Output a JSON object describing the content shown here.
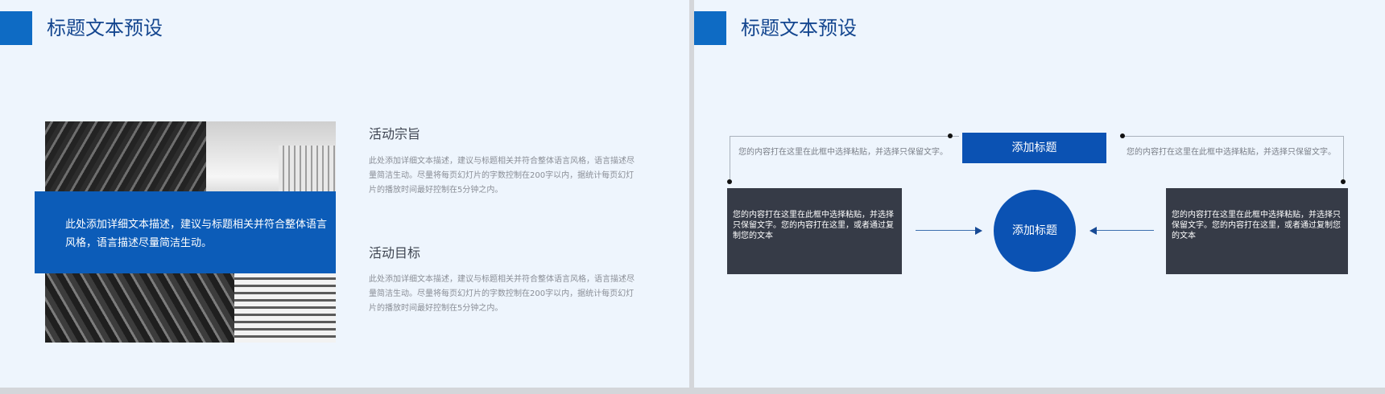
{
  "left_slide": {
    "title": "标题文本预设",
    "overlay_text": "此处添加详细文本描述，建议与标题相关并符合整体语言风格，语言描述尽量简洁生动。",
    "sections": [
      {
        "heading": "活动宗旨",
        "body": "此处添加详细文本描述，建议与标题相关并符合整体语言风格，语言描述尽量简洁生动。尽量将每页幻灯片的字数控制在200字以内，据统计每页幻灯片的播放时间最好控制在5分钟之内。"
      },
      {
        "heading": "活动目标",
        "body": "此处添加详细文本描述，建议与标题相关并符合整体语言风格，语言描述尽量简洁生动。尽量将每页幻灯片的字数控制在200字以内，据统计每页幻灯片的播放时间最好控制在5分钟之内。"
      }
    ]
  },
  "right_slide": {
    "title": "标题文本预设",
    "top_box_label": "添加标题",
    "circle_label": "添加标题",
    "left_note": "您的内容打在这里在此框中选择粘贴，并选择只保留文字。",
    "right_note": "您的内容打在这里在此框中选择粘贴，并选择只保留文字。",
    "left_box_text": "您的内容打在这里在此框中选择粘贴，并选择只保留文字。您的内容打在这里，或者通过复制您的文本",
    "right_box_text": "您的内容打在这里在此框中选择粘贴，并选择只保留文字。您的内容打在这里，或者通过复制您的文本"
  },
  "colors": {
    "accent_blue": "#0b52b3",
    "title_blue": "#14468f",
    "slide_bg": "#eef5fd",
    "dark_box": "#363b47"
  }
}
